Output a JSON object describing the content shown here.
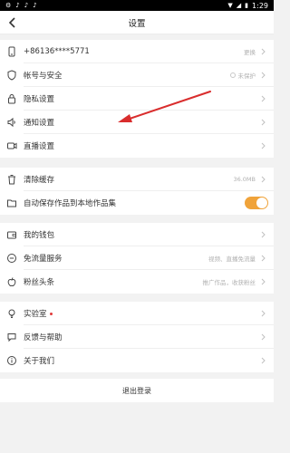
{
  "status_bar": {
    "time": "1:29",
    "notification_icons": [
      "settings-icon",
      "tiktok-icon",
      "tiktok-icon",
      "tiktok-icon"
    ]
  },
  "nav": {
    "title": "设置"
  },
  "sections": {
    "account": [
      {
        "name": "phone",
        "label": "+86136****5771",
        "right": "更换"
      },
      {
        "name": "account-security",
        "label": "帐号与安全",
        "right": "未保护"
      },
      {
        "name": "privacy",
        "label": "隐私设置",
        "right": ""
      },
      {
        "name": "notification",
        "label": "通知设置",
        "right": ""
      },
      {
        "name": "live",
        "label": "直播设置",
        "right": ""
      }
    ],
    "storage": [
      {
        "name": "clear-cache",
        "label": "清除缓存",
        "right": "36.0MB"
      },
      {
        "name": "auto-save",
        "label": "自动保存作品到本地作品集",
        "toggle": true
      }
    ],
    "services": [
      {
        "name": "wallet",
        "label": "我的钱包",
        "right": ""
      },
      {
        "name": "free-data",
        "label": "免流量服务",
        "right": "视频、直播免流量"
      },
      {
        "name": "fans-headline",
        "label": "粉丝头条",
        "right": "推广作品，收获粉丝"
      }
    ],
    "misc": [
      {
        "name": "lab",
        "label": "实验室",
        "right": ""
      },
      {
        "name": "feedback",
        "label": "反馈与帮助",
        "right": ""
      },
      {
        "name": "about",
        "label": "关于我们",
        "right": ""
      }
    ]
  },
  "logout": {
    "label": "退出登录"
  },
  "colors": {
    "toggle_on": "#f0a33a",
    "annotation_arrow": "#d92d2d",
    "lab_dot": "#e13a3a"
  }
}
